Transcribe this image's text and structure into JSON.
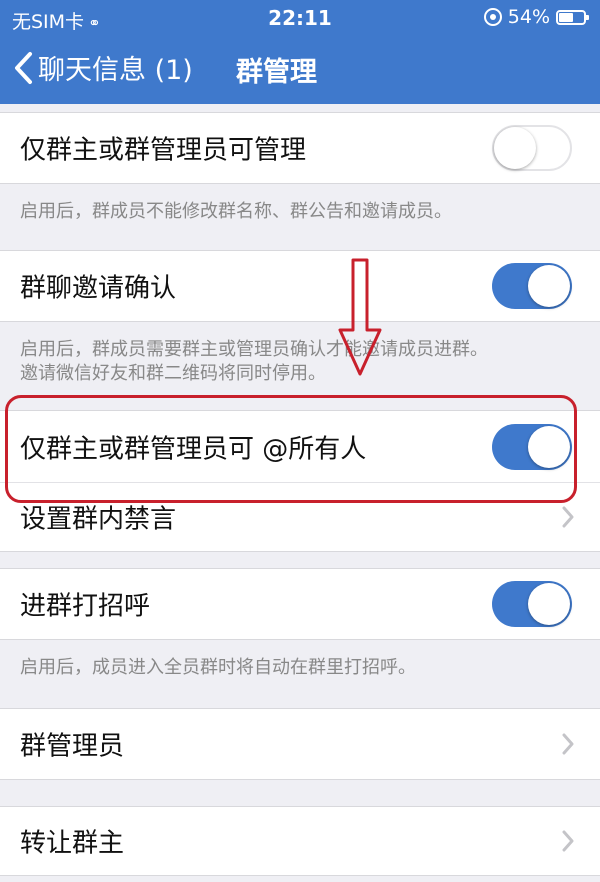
{
  "status_bar": {
    "carrier": "无SIM卡",
    "time": "22:11",
    "battery_percent": "54%",
    "battery_level": 0.54
  },
  "nav": {
    "back_label": "聊天信息 (1)",
    "title": "群管理"
  },
  "settings": {
    "only_owner_admin_manage": {
      "label": "仅群主或群管理员可管理",
      "enabled": false,
      "note": "启用后，群成员不能修改群名称、群公告和邀请成员。"
    },
    "invite_confirm": {
      "label": "群聊邀请确认",
      "enabled": true,
      "note_line1": "启用后，群成员需要群主或管理员确认才能邀请成员进群。",
      "note_line2": "邀请微信好友和群二维码将同时停用。"
    },
    "only_owner_admin_at_all": {
      "label": "仅群主或群管理员可 @所有人",
      "enabled": true
    },
    "group_mute": {
      "label": "设置群内禁言"
    },
    "greet_on_join": {
      "label": "进群打招呼",
      "enabled": true,
      "note": "启用后，成员进入全员群时将自动在群里打招呼。"
    },
    "group_admins": {
      "label": "群管理员"
    },
    "transfer_owner": {
      "label": "转让群主"
    }
  },
  "colors": {
    "header": "#3f79cc",
    "toggle_on": "#3f79cc",
    "annotation_red": "#c8202c"
  },
  "icons": {
    "status_link": "link-icon",
    "status_lock": "rotation-lock-icon",
    "battery": "battery-icon",
    "back": "chevron-left-icon",
    "disclosure": "chevron-right-icon",
    "annotation_arrow": "down-arrow-icon"
  }
}
